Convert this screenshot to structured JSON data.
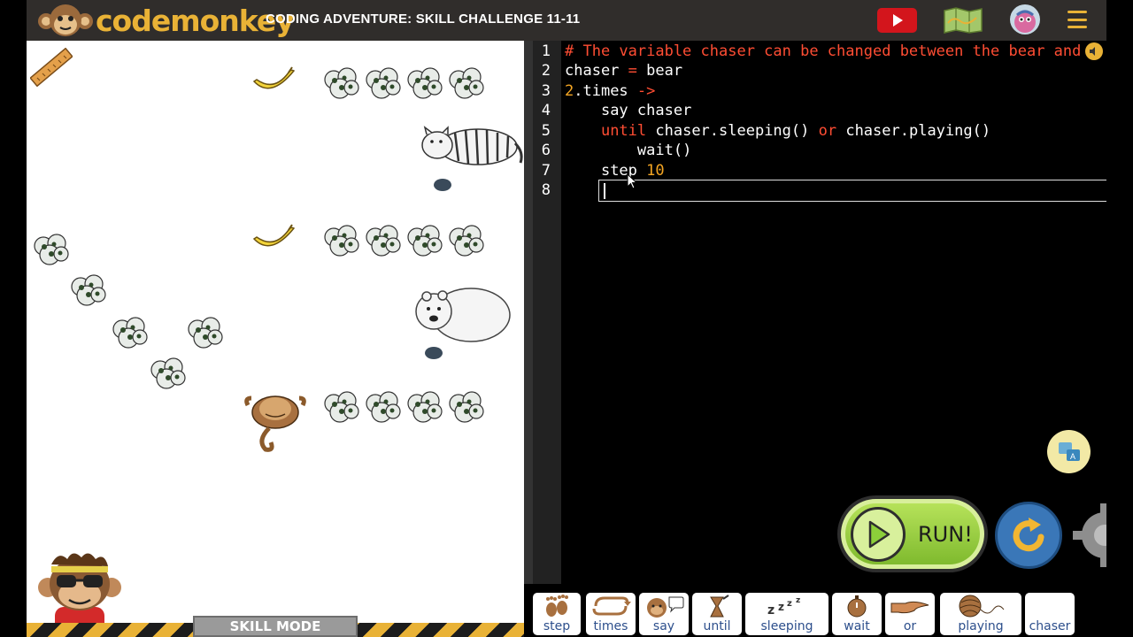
{
  "header": {
    "logo_text": "codemonkey",
    "title": "CODING ADVENTURE: SKILL CHALLENGE 11-11",
    "video_icon": "play-video-icon",
    "map_icon": "map-icon",
    "avatar_icon": "avatar-icon",
    "menu_icon": "hamburger-menu-icon"
  },
  "game": {
    "skill_mode_label": "SKILL MODE",
    "objects": {
      "ruler": "ruler-icon",
      "bananas": 2,
      "chasers": [
        "tiger",
        "bear"
      ],
      "player": "monkey"
    }
  },
  "editor": {
    "line_numbers": [
      "1",
      "2",
      "3",
      "4",
      "5",
      "6",
      "7",
      "8"
    ],
    "comment": "# The variable chaser can be changed between the bear and",
    "line2": {
      "name": "chaser",
      "op": "=",
      "value": "bear"
    },
    "line3": {
      "num": "2",
      "rest": ".times",
      "arrow": "->"
    },
    "line4": {
      "indent": "    ",
      "text": "say chaser"
    },
    "line5": {
      "indent": "    ",
      "kw": "until",
      "a": " chaser.sleeping() ",
      "or": "or",
      "b": " chaser.playing()"
    },
    "line6": {
      "indent": "        ",
      "text": "wait()"
    },
    "line7": {
      "indent": "    ",
      "kw": "step",
      "num": "10"
    },
    "line8": ""
  },
  "controls": {
    "run_label": "RUN!",
    "translate_icon": "translate-icon",
    "reset_icon": "reset-icon",
    "settings_icon": "gear-icon"
  },
  "palette": [
    {
      "label": "step",
      "icon": "footprints-icon"
    },
    {
      "label": "times",
      "icon": "loop-arrow-icon"
    },
    {
      "label": "say",
      "icon": "monkey-speech-icon"
    },
    {
      "label": "until",
      "icon": "hourglass-icon"
    },
    {
      "label": "sleeping",
      "icon": "zzz-icon"
    },
    {
      "label": "wait",
      "icon": "stopwatch-icon"
    },
    {
      "label": "or",
      "icon": "pointing-hand-icon"
    },
    {
      "label": "playing",
      "icon": "yarn-ball-icon"
    },
    {
      "label": "chaser",
      "icon": ""
    }
  ],
  "colors": {
    "brand_yellow": "#e9b236",
    "topbar": "#302d2b",
    "keyword_red": "#ff4d33",
    "number_orange": "#f5a623",
    "run_green": "#7fba2e",
    "palette_text": "#2d4f8c"
  }
}
